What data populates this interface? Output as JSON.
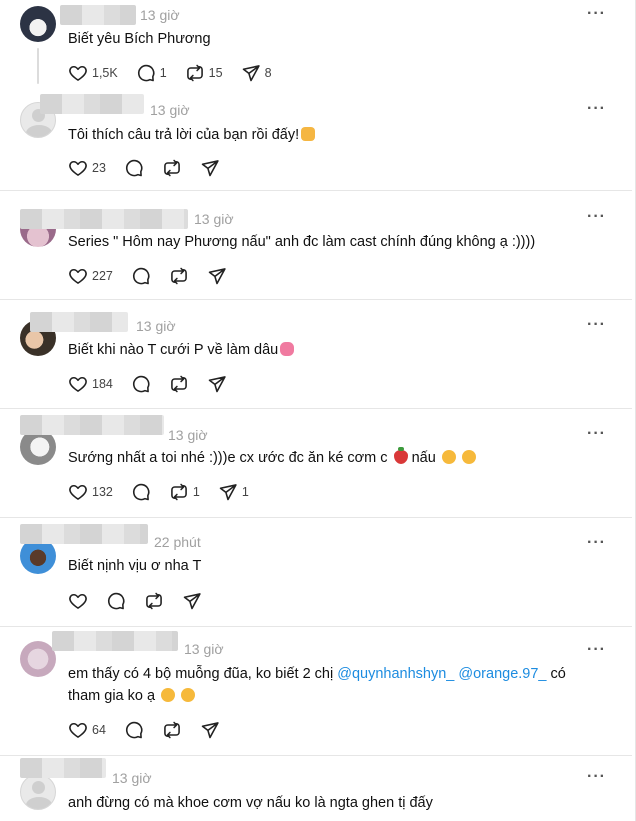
{
  "colors": {
    "mention": "#1d8ce0",
    "muted": "#a0a0a0",
    "divider": "#e6e6e6"
  },
  "posts": [
    {
      "time": "13 giờ",
      "text": "Biết yêu Bích Phương",
      "likes": "1,5K",
      "replies": "1",
      "reposts": "15",
      "shares": "8"
    },
    {
      "time": "13 giờ",
      "text": "Tôi thích câu trả lời của bạn rồi đấy!",
      "emoji": "fist-icon",
      "likes": "23",
      "replies": "",
      "reposts": "",
      "shares": ""
    },
    {
      "time": "13 giờ",
      "text": "Series \" Hôm nay Phương nấu\" anh đc làm cast chính đúng không ạ :))))",
      "likes": "227",
      "replies": "",
      "reposts": "",
      "shares": ""
    },
    {
      "time": "13 giờ",
      "text": "Biết khi nào T cưới P về làm dâu",
      "emoji": "hug-icon",
      "likes": "184",
      "replies": "",
      "reposts": "",
      "shares": ""
    },
    {
      "time": "13 giờ",
      "text_a": "Sướng nhất a toi nhé :)))e cx ước đc ăn ké cơm c",
      "text_b": "nấu",
      "likes": "132",
      "replies": "",
      "reposts": "1",
      "shares": "1"
    },
    {
      "time": "22 phút",
      "text": "Biết nịnh vịu ơ nha T",
      "likes": "",
      "replies": "",
      "reposts": "",
      "shares": ""
    },
    {
      "time": "13 giờ",
      "line1_a": "em thấy có 4 bộ muỗng đũa, ko biết 2 chị",
      "mention1": "@quynhanhshyn_",
      "mention2": "@orange.97_",
      "line1_b": "có",
      "line2": "tham gia ko ạ",
      "likes": "64",
      "replies": "",
      "reposts": "",
      "shares": ""
    },
    {
      "time": "13 giờ",
      "text": "anh đừng có mà khoe cơm vợ nấu ko là ngta ghen tị đấy"
    }
  ],
  "more_label": "···"
}
